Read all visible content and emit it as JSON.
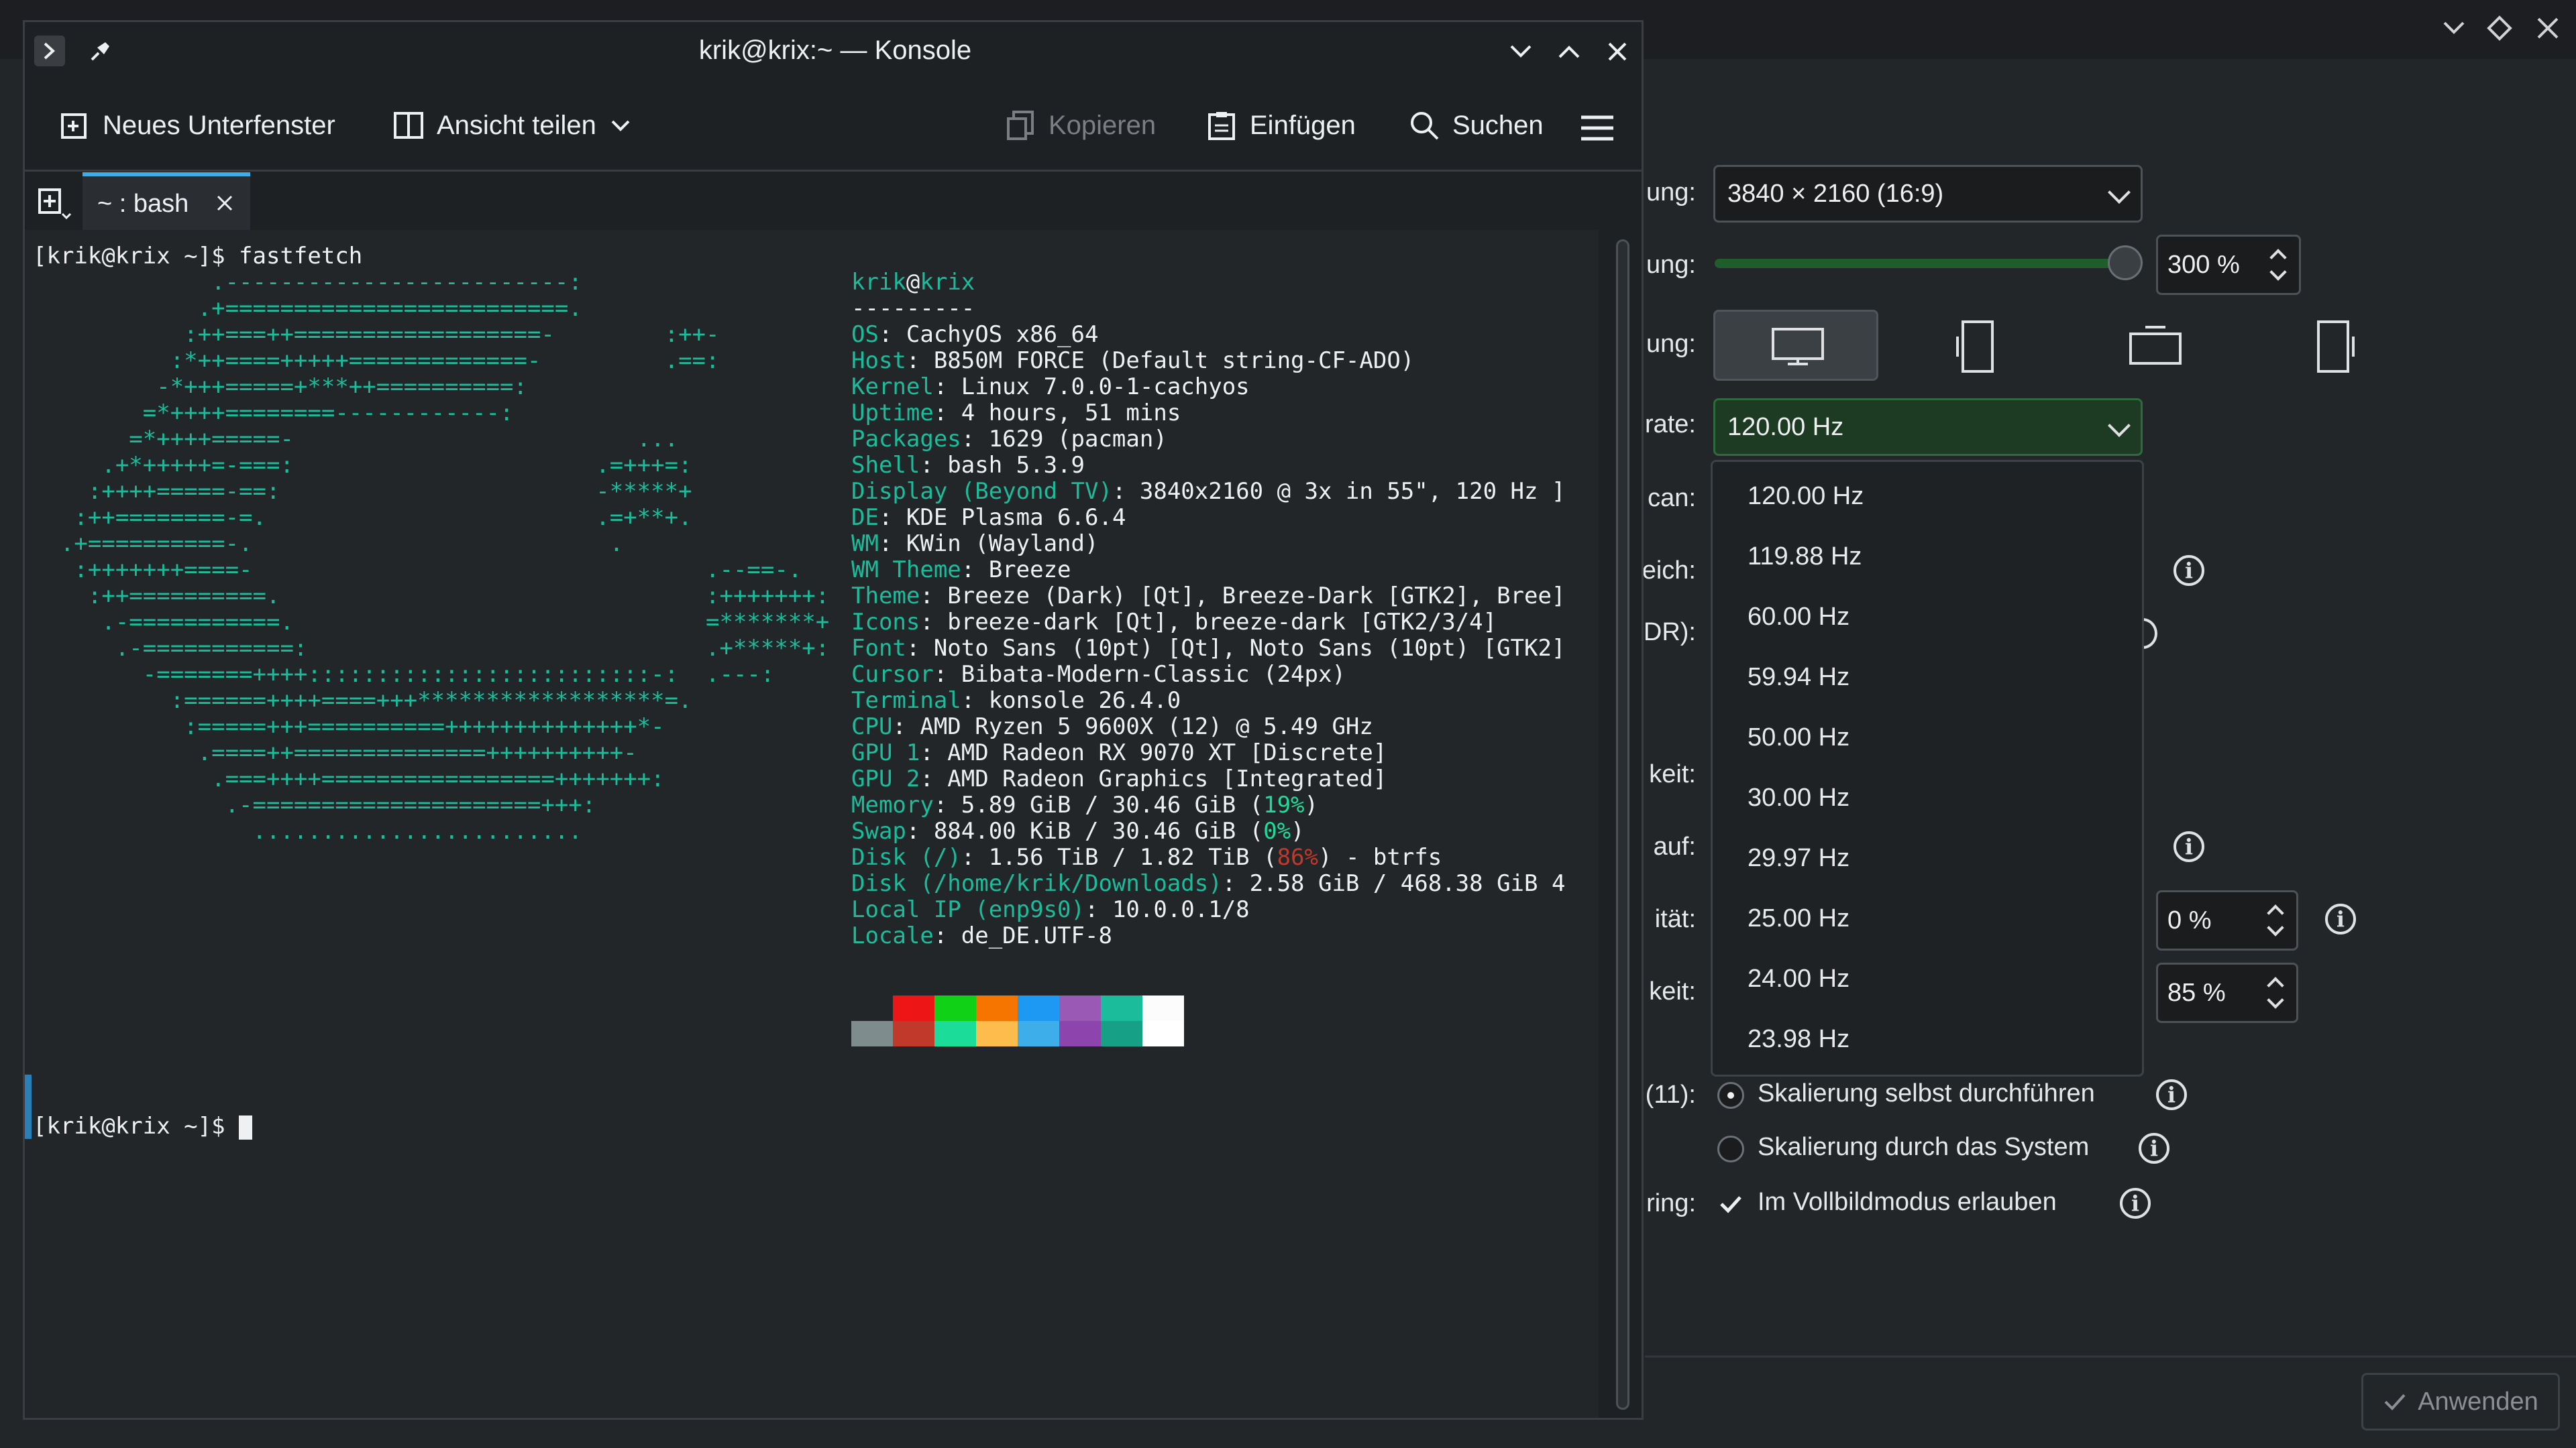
{
  "konsole": {
    "title": "krik@krix:~ — Konsole",
    "toolbar": {
      "new_tab": "Neues Unterfenster",
      "split_view": "Ansicht teilen",
      "copy": "Kopieren",
      "paste": "Einfügen",
      "search": "Suchen"
    },
    "tab_label": "~ : bash",
    "prompt1": "[krik@krix ~]$ fastfetch",
    "prompt2": "[krik@krix ~]$ ",
    "logo_lines": [
      "             .-------------------------:",
      "            .+=========================.",
      "           :++===++==================-        :++-",
      "          :*++====+++++=============-         .==:",
      "         -*+++=====+***++==========:",
      "        =*++++========------------:",
      "       =*++++=====-                         ...",
      "     .+*+++++=-===:                      .=+++=:",
      "    :++++=====-==:                       -*****+",
      "   :++========-=.                        .=+**+.",
      "  .+==========-.                          .",
      "   :+++++++====-                                 .--==-.",
      "    :++==========.                               :+++++++:",
      "     .-===========.                              =*******+",
      "      .-===========:                             .+*****+:",
      "        -=======++++:::::::::::::::::::::::::-:  .---:",
      "          :======++++====+++******************=.",
      "           :=====+++==========++++++++++++++*-",
      "            .====++==============++++++++++-",
      "             .===++++=================+++++++:",
      "              .-=====================+++:",
      "                ........................"
    ],
    "info_user": "krik",
    "info_at": "@",
    "info_host": "krix",
    "info_dashes": "---------",
    "info": [
      {
        "k": "OS",
        "v": ": CachyOS x86_64"
      },
      {
        "k": "Host",
        "v": ": B850M FORCE (Default string-CF-ADO)"
      },
      {
        "k": "Kernel",
        "v": ": Linux 7.0.0-1-cachyos"
      },
      {
        "k": "Uptime",
        "v": ": 4 hours, 51 mins"
      },
      {
        "k": "Packages",
        "v": ": 1629 (pacman)"
      },
      {
        "k": "Shell",
        "v": ": bash 5.3.9"
      },
      {
        "k": "Display (Beyond TV)",
        "v": ": 3840x2160 @ 3x in 55\", 120 Hz ]"
      },
      {
        "k": "DE",
        "v": ": KDE Plasma 6.6.4"
      },
      {
        "k": "WM",
        "v": ": KWin (Wayland)"
      },
      {
        "k": "WM Theme",
        "v": ": Breeze"
      },
      {
        "k": "Theme",
        "v": ": Breeze (Dark) [Qt], Breeze-Dark [GTK2], Bree]"
      },
      {
        "k": "Icons",
        "v": ": breeze-dark [Qt], breeze-dark [GTK2/3/4]"
      },
      {
        "k": "Font",
        "v": ": Noto Sans (10pt) [Qt], Noto Sans (10pt) [GTK2]"
      },
      {
        "k": "Cursor",
        "v": ": Bibata-Modern-Classic (24px)"
      },
      {
        "k": "Terminal",
        "v": ": konsole 26.4.0"
      },
      {
        "k": "CPU",
        "v": ": AMD Ryzen 5 9600X (12) @ 5.49 GHz"
      },
      {
        "k": "GPU 1",
        "v": ": AMD Radeon RX 9070 XT [Discrete]"
      },
      {
        "k": "GPU 2",
        "v": ": AMD Radeon Graphics [Integrated]"
      }
    ],
    "memory": {
      "k": "Memory",
      "a": ": 5.89 GiB / 30.46 GiB (",
      "pct": "19%",
      "b": ")"
    },
    "swap": {
      "k": "Swap",
      "a": ": 884.00 KiB / 30.46 GiB (",
      "pct": "0%",
      "b": ")"
    },
    "disk1": {
      "k": "Disk (/)",
      "a": ": 1.56 TiB / 1.82 TiB (",
      "pct": "86%",
      "b": ") - btrfs"
    },
    "disk2": {
      "k": "Disk (/home/krik/Downloads)",
      "v": ": 2.58 GiB / 468.38 GiB 4"
    },
    "localip": {
      "k": "Local IP (enp9s0)",
      "v": ": 10.0.0.1/8"
    },
    "locale": {
      "k": "Locale",
      "v": ": de_DE.UTF-8"
    },
    "palette_top": [
      "#232629",
      "#ed1515",
      "#11d116",
      "#f67400",
      "#1d99f3",
      "#9b59b6",
      "#1abc9c",
      "#fcfcfc"
    ],
    "palette_bottom": [
      "#7f8c8d",
      "#c0392b",
      "#1cdc9a",
      "#fdbc4b",
      "#3daee9",
      "#8e44ad",
      "#16a085",
      "#ffffff"
    ]
  },
  "settings": {
    "labels": {
      "resolution": "ung:",
      "scale": "ung:",
      "orientation": "ung:",
      "refresh": "rate:",
      "overscan": "can:",
      "range": "eich:",
      "hdr": "DR):",
      "keit": "keit:",
      "auf": "auf:",
      "itat": "ität:",
      "keit2": "keit:",
      "x11": "(11):",
      "ring": "ring:"
    },
    "resolution_value": "3840 × 2160 (16:9)",
    "scale_value": "300 %",
    "refresh_value": "120.00 Hz",
    "refresh_options": [
      "120.00 Hz",
      "119.88 Hz",
      "60.00 Hz",
      "59.94 Hz",
      "50.00 Hz",
      "30.00 Hz",
      "29.97 Hz",
      "25.00 Hz",
      "24.00 Hz",
      "23.98 Hz"
    ],
    "spin_a": "0 %",
    "spin_b": "85 %",
    "radio_self": "Skalierung selbst durchführen",
    "radio_system": "Skalierung durch das System",
    "check_fullscreen": "Im Vollbildmodus erlauben",
    "apply": "Anwenden"
  }
}
